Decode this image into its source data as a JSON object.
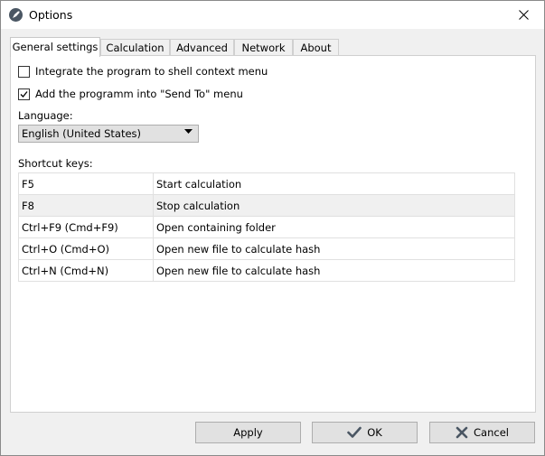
{
  "window": {
    "title": "Options"
  },
  "tabs": [
    {
      "label": "General settings",
      "active": true
    },
    {
      "label": "Calculation",
      "active": false
    },
    {
      "label": "Advanced",
      "active": false
    },
    {
      "label": "Network",
      "active": false
    },
    {
      "label": "About",
      "active": false
    }
  ],
  "general": {
    "options": [
      {
        "label": "Integrate the program to shell context menu",
        "checked": false
      },
      {
        "label": "Add the programm into \"Send To\" menu",
        "checked": true
      }
    ],
    "language_label": "Language:",
    "language_value": "English (United States)",
    "shortcut_label": "Shortcut keys:",
    "shortcuts": [
      {
        "key": "F5",
        "action": "Start calculation"
      },
      {
        "key": "F8",
        "action": "Stop calculation"
      },
      {
        "key": "Ctrl+F9 (Cmd+F9)",
        "action": "Open containing folder"
      },
      {
        "key": "Ctrl+O (Cmd+O)",
        "action": "Open new file to calculate hash"
      },
      {
        "key": "Ctrl+N (Cmd+N)",
        "action": "Open new file to calculate hash"
      }
    ]
  },
  "buttons": {
    "apply": "Apply",
    "ok": "OK",
    "cancel": "Cancel"
  },
  "icons": {
    "app": "rocket-icon",
    "close": "close-icon",
    "ok": "checkmark-icon",
    "cancel": "x-icon",
    "dropdown": "triangle-down-icon"
  },
  "colors": {
    "window_bg": "#f0f0f0",
    "panel_bg": "#ffffff",
    "button_bg": "#e1e1e1",
    "app_icon": "#4a5663"
  }
}
